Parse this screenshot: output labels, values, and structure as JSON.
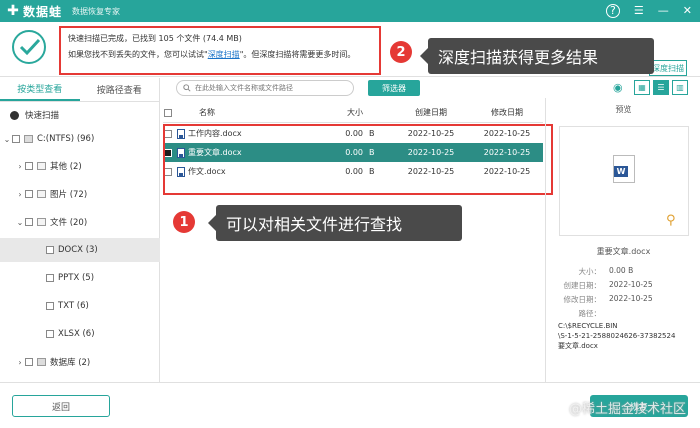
{
  "app": {
    "name": "数据蛙",
    "subtitle": "数据恢复专家"
  },
  "header": {
    "msg_prefix": "快速扫描已完成，已找到",
    "file_count": "105",
    "msg_mid": "个文件",
    "total_size": "(74.4 MB)",
    "hint_prefix": "如果您找不到丢失的文件，您可以试试\"",
    "deep_link": "深度扫描",
    "hint_suffix": "\"。但深度扫描将需要更多时间。",
    "deep_button": "深度扫描"
  },
  "callouts": [
    {
      "num": "2",
      "text": "深度扫描获得更多结果"
    },
    {
      "num": "1",
      "text": "可以对相关文件进行查找"
    }
  ],
  "tabs": [
    {
      "label": "按类型查看"
    },
    {
      "label": "按路径查看"
    }
  ],
  "quick_scan_label": "快速扫描",
  "tree": {
    "drive": "C:(NTFS) (96)",
    "other": "其他 (2)",
    "images": "图片 (72)",
    "docs": "文件 (20)",
    "docx": "DOCX (3)",
    "pptx": "PPTX (5)",
    "txt": "TXT (6)",
    "xlsx": "XLSX (6)",
    "db": "数据库 (2)"
  },
  "search": {
    "placeholder": "在此处输入文件名称或文件路径"
  },
  "filter_label": "筛选器",
  "table": {
    "headers": {
      "name": "名称",
      "size": "大小",
      "created": "创建日期",
      "modified": "修改日期"
    },
    "rows": [
      {
        "name": "工作内容.docx",
        "size": "0.00",
        "unit": "B",
        "created": "2022-10-25",
        "modified": "2022-10-25"
      },
      {
        "name": "重要文章.docx",
        "size": "0.00",
        "unit": "B",
        "created": "2022-10-25",
        "modified": "2022-10-25"
      },
      {
        "name": "作文.docx",
        "size": "0.00",
        "unit": "B",
        "created": "2022-10-25",
        "modified": "2022-10-25"
      }
    ]
  },
  "preview": {
    "title": "预览",
    "file_name": "重要文章.docx",
    "size_label": "大小：",
    "size_value": "0.00  B",
    "created_label": "创建日期：",
    "created_value": "2022-10-25",
    "modified_label": "修改日期：",
    "modified_value": "2022-10-25",
    "path_label": "路径：",
    "path_line1": "C:\\$RECYCLE.BIN",
    "path_line2": "\\S-1-5-21-2588024626-37382524",
    "path_line3": "要文章.docx"
  },
  "bottom": {
    "back": "返回",
    "recover": "恢复",
    "watermark": "@稀土掘金技术社区"
  },
  "colors": {
    "accent": "#27a59b",
    "highlight": "#e53935",
    "selected_row": "#2c8d85"
  }
}
